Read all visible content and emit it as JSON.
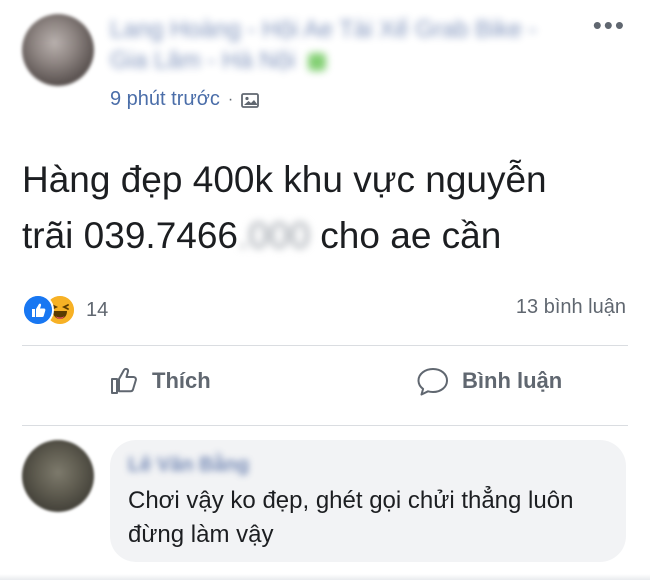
{
  "post": {
    "author_name": "Lang Hoàng - Hội Ae Tài Xế Grab Bike - Gia Lâm - Hà Nội",
    "timestamp": "9 phút trước",
    "separator": "·",
    "more_glyph": "•••",
    "privacy_icon": "photo-icon",
    "text_line1": "Hàng đẹp 400k khu vực nguyễn",
    "text_line2_prefix": "trãi 039.7466",
    "text_line2_blur": ".000",
    "text_line2_suffix": " cho ae cần"
  },
  "reactions": {
    "count": "14",
    "icons": [
      "like-icon",
      "haha-icon"
    ],
    "like_color": "#1877f2",
    "haha_color": "#f7b125",
    "comments_label": "13 bình luận"
  },
  "actions": {
    "like_label": "Thích",
    "comment_label": "Bình luận"
  },
  "comment": {
    "author_name": "Lê Văn Bằng",
    "text": "Chơi vậy ko đẹp, ghét gọi chửi thẳng luôn đừng làm vậy"
  },
  "colors": {
    "link": "#3b5998",
    "meta": "#4b6ea9",
    "muted": "#606770",
    "bubble": "#f2f3f5"
  }
}
